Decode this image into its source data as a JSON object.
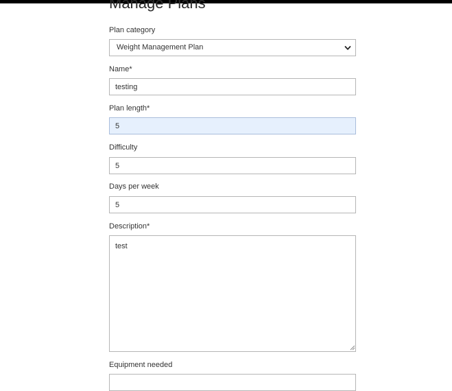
{
  "page": {
    "title": "Manage Plans"
  },
  "form": {
    "plan_category": {
      "label": "Plan category",
      "value": "Weight Management Plan"
    },
    "name": {
      "label": "Name*",
      "value": "testing"
    },
    "plan_length": {
      "label": "Plan length*",
      "value": "5"
    },
    "difficulty": {
      "label": "Difficulty",
      "value": "5"
    },
    "days_per_week": {
      "label": "Days per week",
      "value": "5"
    },
    "description": {
      "label": "Description*",
      "value": "test"
    },
    "equipment_needed": {
      "label": "Equipment needed"
    }
  },
  "icons": {
    "select_arrow": "chevron-down-icon",
    "resize": "resize-grip-icon"
  }
}
